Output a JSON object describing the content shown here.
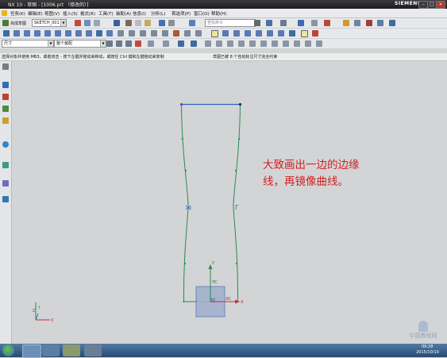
{
  "window": {
    "title": "NX 10 - 草图 - [1006.prt （修改的）]",
    "brand": "SIEMENS"
  },
  "menu": [
    "任务(K)",
    "编辑(E)",
    "视图(V)",
    "插入(S)",
    "格式(R)",
    "工具(T)",
    "装配(A)",
    "信息(I)",
    "分析(L)",
    "首选项(P)",
    "窗口(O)",
    "帮助(H)"
  ],
  "toolbar": {
    "finish_sketch": "完成草图",
    "sketch_name": "SKETCH_001",
    "search_placeholder": "查找命令",
    "dim_type": "尺寸",
    "constraint_filter": "整个装配"
  },
  "status": {
    "prompt": "选择对象并使用 MB3，或者双击 - 按下左键并拖动来移动，或按住 Ctrl 键和左键拖动来复制",
    "constraint_info": "草图已被 8 个自动标注尺寸完全约束"
  },
  "annotation": {
    "line1": "大致画出一边的边缘",
    "line2": "线，再镜像曲线。"
  },
  "axes": {
    "sketch_x": "XC",
    "sketch_y": "YC",
    "abs_x": "X",
    "abs_y": "Y"
  },
  "clock": {
    "time": "09:28",
    "date": "2015/10/19"
  },
  "watermark": "中国教程网"
}
